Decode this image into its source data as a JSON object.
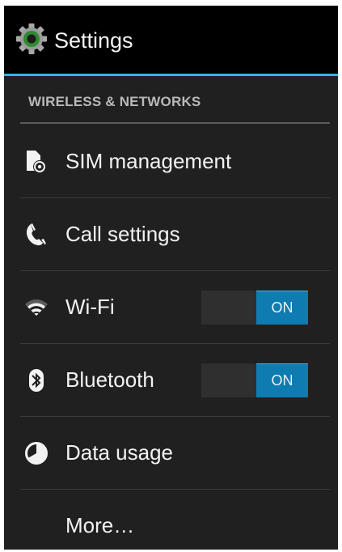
{
  "action_bar": {
    "title": "Settings",
    "icon": "settings-gear-icon"
  },
  "section": {
    "header": "WIRELESS & NETWORKS"
  },
  "items": [
    {
      "label": "SIM management",
      "icon": "sim-management-icon"
    },
    {
      "label": "Call settings",
      "icon": "phone-handset-icon"
    },
    {
      "label": "Wi-Fi",
      "icon": "wifi-icon",
      "toggle": "ON"
    },
    {
      "label": "Bluetooth",
      "icon": "bluetooth-icon",
      "toggle": "ON"
    },
    {
      "label": "Data usage",
      "icon": "data-usage-icon"
    },
    {
      "label": "More…"
    }
  ],
  "colors": {
    "accent": "#33b5e5",
    "toggle_on": "#0e7bb1",
    "background": "#202020",
    "action_bar": "#000000"
  }
}
